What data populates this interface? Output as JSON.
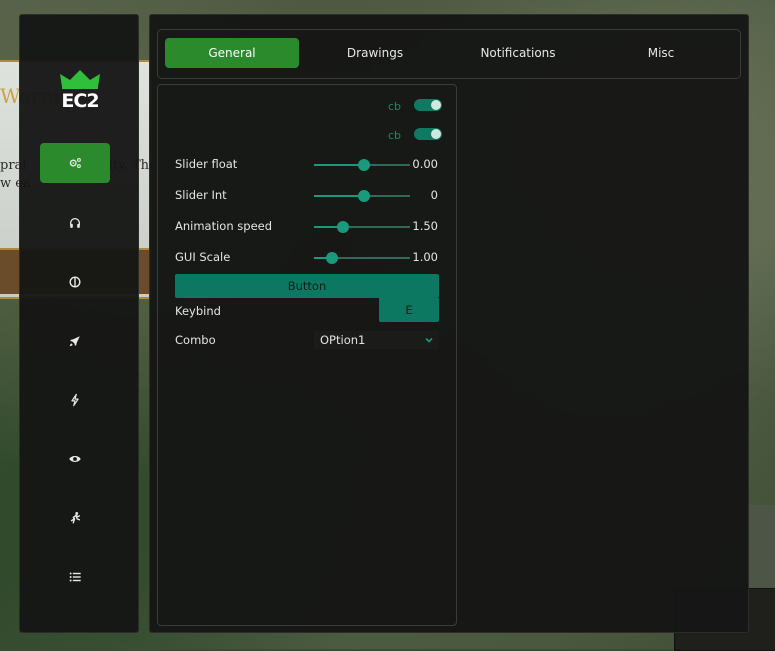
{
  "background": {
    "title_fragment": "Warni",
    "line1_fragment": "pral",
    "line1_fragment2": "tivity. The",
    "line2_fragment": "w ea"
  },
  "logo": {
    "text": "EC2",
    "crown_color": "#2fbf3a"
  },
  "sidebar": {
    "items": [
      {
        "icon": "settings-gear-icon",
        "active": true
      },
      {
        "icon": "headset-icon",
        "active": false
      },
      {
        "icon": "contrast-circle-icon",
        "active": false
      },
      {
        "icon": "rocket-icon",
        "active": false
      },
      {
        "icon": "lightning-icon",
        "active": false
      },
      {
        "icon": "eye-icon",
        "active": false
      },
      {
        "icon": "running-person-icon",
        "active": false
      },
      {
        "icon": "list-icon",
        "active": false
      }
    ]
  },
  "tabs": [
    {
      "label": "General",
      "active": true
    },
    {
      "label": "Drawings",
      "active": false
    },
    {
      "label": "Notifications",
      "active": false
    },
    {
      "label": "Misc",
      "active": false
    }
  ],
  "general": {
    "checkboxes": [
      {
        "label": "cb",
        "checked": true
      },
      {
        "label": "cb",
        "checked": true
      }
    ],
    "sliders": [
      {
        "label": "Slider float",
        "value": "0.00",
        "fraction": 0.52
      },
      {
        "label": "Slider Int",
        "value": "0",
        "fraction": 0.52
      },
      {
        "label": "Animation speed",
        "value": "1.50",
        "fraction": 0.3
      },
      {
        "label": "GUI Scale",
        "value": "1.00",
        "fraction": 0.19
      }
    ],
    "button_label": "Button",
    "keybind": {
      "label": "Keybind",
      "value": "E"
    },
    "combo": {
      "label": "Combo",
      "value": "OPtion1"
    }
  },
  "colors": {
    "accent_green": "#2a8a2c",
    "teal": "#0c7862",
    "teal_bright": "#1a9a7c",
    "panel_bg": "#151615"
  }
}
